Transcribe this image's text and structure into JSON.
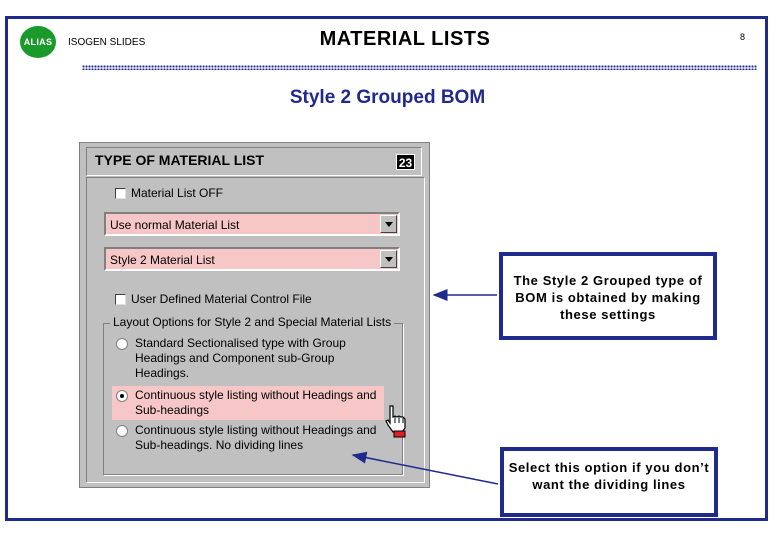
{
  "header": {
    "logo_text": "ALIAS",
    "slides_label": "ISOGEN SLIDES",
    "title": "MATERIAL LISTS",
    "page_number": "8",
    "subtitle": "Style 2 Grouped BOM"
  },
  "dialog": {
    "title": "TYPE OF MATERIAL LIST",
    "badge": "23",
    "material_list_off": {
      "label": "Material List OFF",
      "checked": false
    },
    "combo1": {
      "value": "Use normal Material List"
    },
    "combo2": {
      "value": "Style 2 Material List"
    },
    "user_defined": {
      "label": "User Defined Material Control File",
      "checked": false
    },
    "layout_group": {
      "legend": "Layout Options for Style 2 and Special Material Lists",
      "options": [
        {
          "label": "Standard Sectionalised type with Group Headings and Component sub-Group Headings.",
          "selected": false
        },
        {
          "label": "Continuous style listing without Headings and Sub-headings",
          "selected": true
        },
        {
          "label": "Continuous style listing without Headings and Sub-headings. No dividing lines",
          "selected": false
        }
      ]
    }
  },
  "callouts": {
    "first": "The Style 2 Grouped type of BOM is obtained by making these settings",
    "second": "Select this option if you don’t want the dividing lines"
  },
  "colors": {
    "frame_blue": "#1f2a8c",
    "highlight_pink": "#f7c6c6",
    "logo_green": "#1a9a2a",
    "dialog_gray": "#c0c0c0"
  },
  "icons": [
    "pointing-hand-cursor-icon",
    "chevron-down-icon",
    "arrow-left-icon"
  ]
}
